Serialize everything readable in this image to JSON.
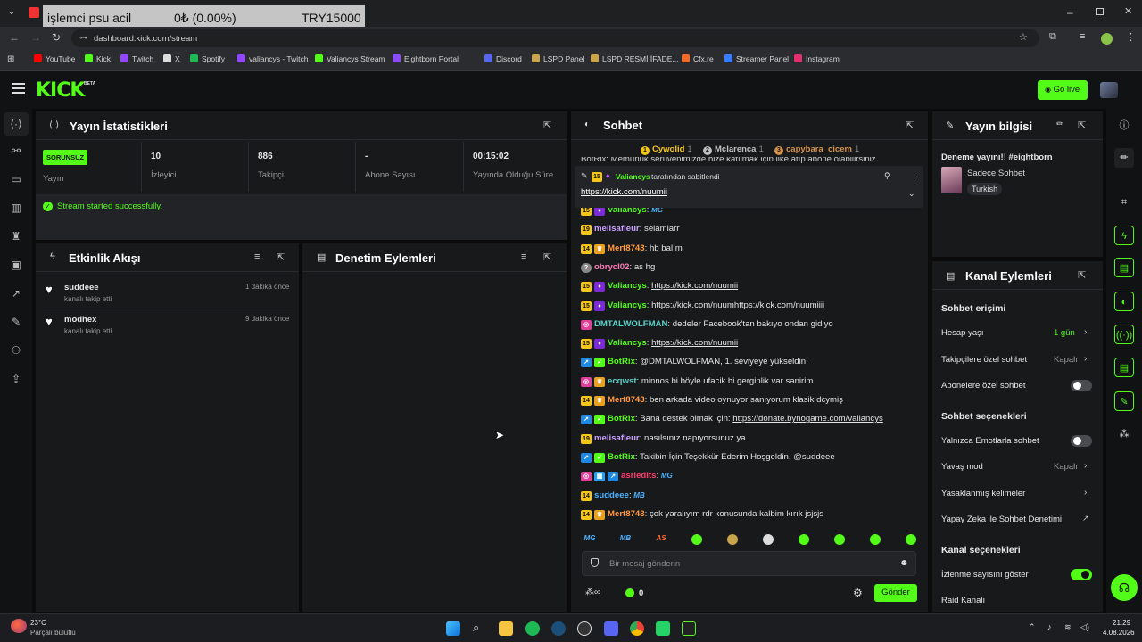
{
  "browser": {
    "tab_title": "işlemci psu acil",
    "ticker_crypto": "0₺ (0.00%)",
    "ticker_currency": "TRY15000",
    "url": "dashboard.kick.com/stream",
    "bookmarks": [
      {
        "label": "YouTube",
        "color": "#ff0000"
      },
      {
        "label": "Kick",
        "color": "#53fc18"
      },
      {
        "label": "Twitch",
        "color": "#9146ff"
      },
      {
        "label": "X",
        "color": "#dddddd"
      },
      {
        "label": "Spotify",
        "color": "#1db954"
      },
      {
        "label": "valiancys - Twitch",
        "color": "#9146ff"
      },
      {
        "label": "Valiancys Stream",
        "color": "#53fc18"
      },
      {
        "label": "Eightborn Portal",
        "color": "#8a4bff"
      },
      {
        "label": "Discord",
        "color": "#5865f2"
      },
      {
        "label": "LSPD Panel",
        "color": "#c8a44a"
      },
      {
        "label": "LSPD  RESMİ İFADE...",
        "color": "#c8a44a"
      },
      {
        "label": "Cfx.re",
        "color": "#f06a2a"
      },
      {
        "label": "Streamer Panel",
        "color": "#3a7bff"
      },
      {
        "label": "Instagram",
        "color": "#e1306c"
      }
    ]
  },
  "header": {
    "logo": "KICK",
    "logo_beta": "BETA",
    "go_live": "Go live"
  },
  "stats": {
    "title": "Yayın İstatistikleri",
    "badge": "SORUNSUZ",
    "badge_caption": "Yayın",
    "viewers_value": "10",
    "viewers_label": "İzleyici",
    "followers_value": "886",
    "followers_label": "Takipçi",
    "subs_value": "-",
    "subs_label": "Abone Sayısı",
    "uptime_value": "00:15:02",
    "uptime_label": "Yayında Olduğu Süre",
    "success_msg": "Stream started successfully."
  },
  "activity": {
    "title": "Etkinlik Akışı",
    "items": [
      {
        "user": "suddeee",
        "action": "kanalı takip etti",
        "time": "1 dakika önce"
      },
      {
        "user": "modhex",
        "action": "kanalı takip etti",
        "time": "9 dakika önce"
      }
    ]
  },
  "moderation": {
    "title": "Denetim Eylemleri"
  },
  "chat": {
    "title": "Sohbet",
    "top_gifters": [
      {
        "name": "Cywolid",
        "count": "1",
        "rank": "1",
        "color": "#f5c518"
      },
      {
        "name": "Mclarenca",
        "count": "1",
        "rank": "2",
        "color": "#c0c0c0"
      },
      {
        "name": "capybara_cicem",
        "count": "1",
        "rank": "3",
        "color": "#d4924a"
      }
    ],
    "partial_top": "BotRix: Memurluk serüvenimizde bize katılmak için like atıp abone olabilirsiniz",
    "pinned_by_user": "Valiancys",
    "pinned_by_text": "tarafından sabitlendi",
    "pinned_badge": "15",
    "pinned_link": "https://kick.com/nuumii",
    "messages": [
      {
        "badges": [
          "15",
          "mic"
        ],
        "user": "Valiancys",
        "color": "#53fc18",
        "text": "",
        "emote": "MG"
      },
      {
        "badges": [
          "19"
        ],
        "user": "melisafleur",
        "color": "#c9a0ff",
        "text": "selamlarr"
      },
      {
        "badges": [
          "14",
          "crown"
        ],
        "user": "Mert8743",
        "color": "#ff9a3d",
        "text": "hb balım"
      },
      {
        "badges": [
          "?"
        ],
        "user": "obrycl02",
        "color": "#ff7ab6",
        "text": "as hg"
      },
      {
        "badges": [
          "15",
          "mic"
        ],
        "user": "Valiancys",
        "color": "#53fc18",
        "link": "https://kick.com/nuumii"
      },
      {
        "badges": [
          "15",
          "mic"
        ],
        "user": "Valiancys",
        "color": "#53fc18",
        "link": "https://kick.com/nuumhttps://kick.com/nuumiiii"
      },
      {
        "badges": [
          "pink"
        ],
        "user": "DMTALWOLFMAN",
        "color": "#5ad1c8",
        "text": "dedeler Facebook'tan bakıyo ondan gidiyo"
      },
      {
        "badges": [
          "15",
          "mic"
        ],
        "user": "Valiancys",
        "color": "#53fc18",
        "link": "https://kick.com/nuumii"
      },
      {
        "badges": [
          "bot",
          "ver"
        ],
        "user": "BotRix",
        "color": "#53fc18",
        "text": "@DMTALWOLFMAN, 1. seviyeye yükseldin."
      },
      {
        "badges": [
          "pink",
          "crown"
        ],
        "user": "ecqwst",
        "color": "#5ad1c8",
        "text": "minnos bi böyle ufacik bi gerginlik var sanirim"
      },
      {
        "badges": [
          "14",
          "crown"
        ],
        "user": "Mert8743",
        "color": "#ff9a3d",
        "text": "ben arkada video oynuyor sanıyorum klasik dcymiş"
      },
      {
        "badges": [
          "bot",
          "ver"
        ],
        "user": "BotRix",
        "color": "#53fc18",
        "text": "Bana destek olmak için: ",
        "link": "https://donate.bynogame.com/valiancys"
      },
      {
        "badges": [
          "19"
        ],
        "user": "melisafleur",
        "color": "#c9a0ff",
        "text": "nasılsınız napıyorsunuz ya"
      },
      {
        "badges": [
          "bot",
          "ver"
        ],
        "user": "BotRix",
        "color": "#53fc18",
        "text": "Takibin İçin Teşekkür Ederim Hoşgeldin. @suddeee"
      },
      {
        "badges": [
          "pink",
          "grid",
          "bot"
        ],
        "user": "asriedits",
        "color": "#ff3d6e",
        "text": "",
        "emote": "MG"
      },
      {
        "badges": [
          "14"
        ],
        "user": "suddeee",
        "color": "#4db3ff",
        "text": "",
        "emote": "MB"
      },
      {
        "badges": [
          "14",
          "crown"
        ],
        "user": "Mert8743",
        "color": "#ff9a3d",
        "text": "çok yaralıyım rdr konusunda kalbim kırık jsjsjs"
      }
    ],
    "emote_bar": [
      "MG",
      "MB",
      "AS",
      "e4",
      "e5",
      "e6",
      "e7",
      "e8",
      "e9",
      "e10"
    ],
    "input_placeholder": "Bir mesaj gönderin",
    "points": "0",
    "send_label": "Gönder"
  },
  "stream_info": {
    "title": "Yayın bilgisi",
    "stream_title": "Deneme yayını!! #eightborn",
    "category": "Sadece Sohbet",
    "language": "Turkish"
  },
  "channel_actions": {
    "title": "Kanal Eylemleri",
    "chat_access_header": "Sohbet erişimi",
    "account_age_label": "Hesap yaşı",
    "account_age_value": "1 gün",
    "followers_only_label": "Takipçilere özel sohbet",
    "followers_only_value": "Kapalı",
    "subs_only_label": "Abonelere özel sohbet",
    "chat_options_header": "Sohbet seçenekleri",
    "emote_only_label": "Yalnızca Emotlarla sohbet",
    "slow_mode_label": "Yavaş mod",
    "slow_mode_value": "Kapalı",
    "banned_words_label": "Yasaklanmış kelimeler",
    "ai_mod_label": "Yapay Zeka ile Sohbet Denetimi",
    "channel_options_header": "Kanal seçenekleri",
    "show_viewers_label": "İzlenme sayısını göster",
    "raid_label": "Raid Kanalı"
  },
  "taskbar": {
    "temp": "23°C",
    "weather": "Parçalı bulutlu",
    "time": "21:29",
    "date": "4.08.2026"
  }
}
